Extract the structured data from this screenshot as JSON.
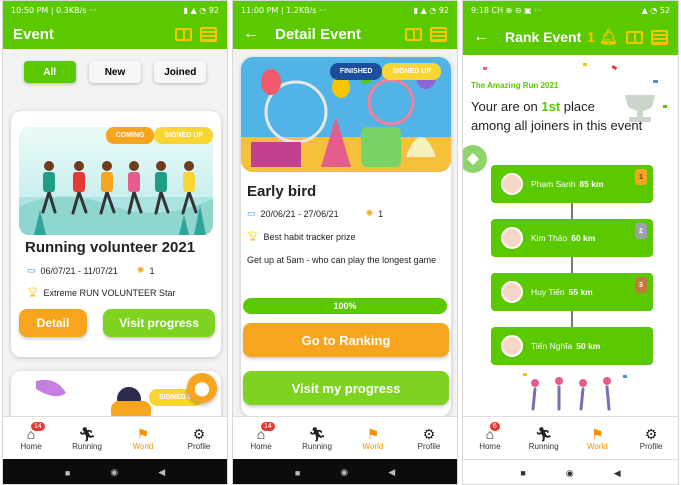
{
  "colors": {
    "primary_green": "#5bc900",
    "accent_orange": "#f7a41e",
    "accent_yellow": "#f9d533",
    "light_green": "#7ed321",
    "badge_red": "#e53935"
  },
  "phone1": {
    "status_time": "10:50 PM | 0.3KB/s ···",
    "status_right": "▮ ▲ ◔ 92",
    "title": "Event",
    "filters": [
      "All",
      "New",
      "Joined"
    ],
    "card1": {
      "tag1": "COMING",
      "tag2": "SIGNED UP",
      "title": "Running volunteer 2021",
      "dates": "06/07/21 - 11/07/21",
      "count": "1",
      "prize": "Extreme RUN VOLUNTEER Star",
      "btn_detail": "Detail",
      "btn_progress": "Visit progress"
    },
    "card2": {
      "tag": "SIGNED U"
    }
  },
  "phone2": {
    "status_time": "11:00 PM | 1.2KB/s ···",
    "status_right": "▮ ▲ ◔ 92",
    "title": "Detail Event",
    "tag1": "FINISHED",
    "tag2": "SIGNED UP",
    "event_title": "Early bird",
    "dates": "20/06/21 - 27/06/21",
    "count": "1",
    "prize": "Best habit tracker prize",
    "description": "Get up at 5am - who can play the longest game",
    "progress": "100%",
    "progress_value": 100,
    "btn_ranking": "Go to Ranking",
    "btn_progress": "Visit my progress"
  },
  "phone3": {
    "status_time": "9:18 CH ⊕ ⊖ ▣ ···",
    "status_right": "▲ ◔ 52",
    "title": "Rank Event",
    "notification_count": "1",
    "event_name": "The Amazing Run 2021",
    "rank_prefix": "Your are on",
    "rank": "1st",
    "rank_suffix": "place",
    "rank_line2": "among all joiners in this event",
    "ranking": [
      {
        "name": "Phạm Sanh",
        "distance": "85 km",
        "medal": "1"
      },
      {
        "name": "Kim Thảo",
        "distance": "60 km",
        "medal": "2"
      },
      {
        "name": "Huy Tiến",
        "distance": "55 km",
        "medal": "3"
      },
      {
        "name": "Tiến Nghĩa",
        "distance": "50 km",
        "medal": ""
      }
    ]
  },
  "nav": {
    "home": "Home",
    "running": "Running",
    "world": "World",
    "profile": "Profile",
    "badge_p1": "14",
    "badge_p2": "14",
    "badge_p3": "6"
  },
  "icons": {
    "book": "book-icon",
    "list": "list-icon",
    "bell": "bell-icon",
    "home": "home-icon",
    "running": "running-icon",
    "world": "flag-icon",
    "profile": "profile-gear-icon",
    "location": "location-pin-icon",
    "calendar": "calendar-icon",
    "users": "users-icon",
    "trophy": "trophy-icon"
  }
}
